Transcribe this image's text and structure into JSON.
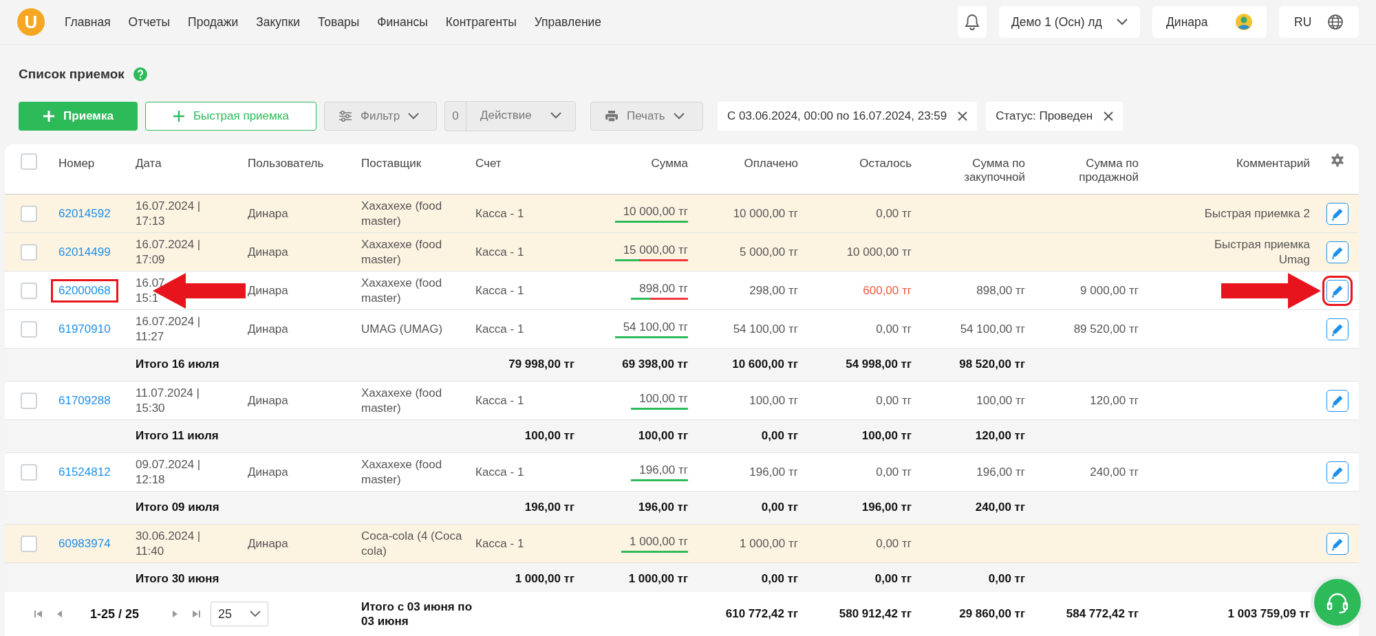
{
  "nav": {
    "logo": "U",
    "items": [
      "Главная",
      "Отчеты",
      "Продажи",
      "Закупки",
      "Товары",
      "Финансы",
      "Контрагенты",
      "Управление"
    ]
  },
  "header_right": {
    "company": "Демо 1 (Осн) лд",
    "user": "Динара",
    "lang": "RU"
  },
  "page": {
    "title": "Список приемок"
  },
  "toolbar": {
    "add": "Приемка",
    "quick_add": "Быстрая приемка",
    "filter": "Фильтр",
    "action_count": "0",
    "action": "Действие",
    "print": "Печать",
    "chips": [
      {
        "label": "С 03.06.2024, 00:00 по 16.07.2024, 23:59"
      },
      {
        "label": "Статус: Проведен"
      }
    ]
  },
  "table": {
    "all_checked": false,
    "columns": [
      "Номер",
      "Дата",
      "Пользователь",
      "Поставщик",
      "Счет",
      "Сумма",
      "Оплачено",
      "Осталось",
      "Сумма по закупочной",
      "Сумма по продажной",
      "Комментарий"
    ],
    "rows": [
      {
        "kind": "doc",
        "checked": false,
        "highlighted": true,
        "annotated": false,
        "number": "62014592",
        "date": "16.07.2024 |",
        "time": "17:13",
        "user": "Динара",
        "supplier": "Хахахехе (food master)",
        "account": "Касса - 1",
        "sum": "10 000,00 тг",
        "level": 1,
        "paid": "10 000,00 тг",
        "remaining": "0,00 тг",
        "remaining_alert": false,
        "comment": "Быстрая приемка 2"
      },
      {
        "kind": "doc",
        "checked": false,
        "highlighted": true,
        "annotated": false,
        "number": "62014499",
        "date": "16.07.2024 |",
        "time": "17:09",
        "user": "Динара",
        "supplier": "Хахахехе (food master)",
        "account": "Касса - 1",
        "sum": "15 000,00 тг",
        "level": 0.33,
        "paid": "5 000,00 тг",
        "remaining": "10 000,00 тг",
        "remaining_alert": false,
        "comment": "Быстрая приемка Umag"
      },
      {
        "kind": "doc",
        "checked": false,
        "highlighted": false,
        "annotated": true,
        "number": "62000068",
        "date": "16.07",
        "time": "15:1",
        "user": "Динара",
        "supplier": "Хахахехе (food master)",
        "account": "Касса - 1",
        "sum": "898,00 тг",
        "level": 0.33,
        "paid": "298,00 тг",
        "remaining": "600,00 тг",
        "remaining_alert": true,
        "purchase": "898,00 тг",
        "sale": "9 000,00 тг"
      },
      {
        "kind": "doc",
        "checked": false,
        "highlighted": false,
        "annotated": false,
        "number": "61970910",
        "date": "16.07.2024 |",
        "time": "11:27",
        "user": "Динара",
        "supplier": "UMAG (UMAG)",
        "account": "Касса - 1",
        "sum": "54 100,00 тг",
        "level": 1,
        "paid": "54 100,00 тг",
        "remaining": "0,00 тг",
        "remaining_alert": false,
        "purchase": "54 100,00 тг",
        "sale": "89 520,00 тг"
      },
      {
        "kind": "total",
        "label": "Итого 16 июля",
        "sum": "79 998,00 тг",
        "paid": "69 398,00 тг",
        "remaining": "10 600,00 тг",
        "purchase": "54 998,00 тг",
        "sale": "98 520,00 тг"
      },
      {
        "kind": "doc",
        "checked": false,
        "highlighted": false,
        "annotated": false,
        "number": "61709288",
        "date": "11.07.2024 |",
        "time": "15:30",
        "user": "Динара",
        "supplier": "Хахахехе (food master)",
        "account": "Касса - 1",
        "sum": "100,00 тг",
        "level": 1,
        "paid": "100,00 тг",
        "remaining": "0,00 тг",
        "remaining_alert": false,
        "purchase": "100,00 тг",
        "sale": "120,00 тг"
      },
      {
        "kind": "total",
        "label": "Итого 11 июля",
        "sum": "100,00 тг",
        "paid": "100,00 тг",
        "remaining": "0,00 тг",
        "purchase": "100,00 тг",
        "sale": "120,00 тг"
      },
      {
        "kind": "doc",
        "checked": false,
        "highlighted": false,
        "annotated": false,
        "number": "61524812",
        "date": "09.07.2024 |",
        "time": "12:18",
        "user": "Динара",
        "supplier": "Хахахехе (food master)",
        "account": "Касса - 1",
        "sum": "196,00 тг",
        "level": 1,
        "paid": "196,00 тг",
        "remaining": "0,00 тг",
        "remaining_alert": false,
        "purchase": "196,00 тг",
        "sale": "240,00 тг"
      },
      {
        "kind": "total",
        "label": "Итого 09 июля",
        "sum": "196,00 тг",
        "paid": "196,00 тг",
        "remaining": "0,00 тг",
        "purchase": "196,00 тг",
        "sale": "240,00 тг"
      },
      {
        "kind": "doc",
        "checked": false,
        "highlighted": true,
        "annotated": false,
        "number": "60983974",
        "date": "30.06.2024 |",
        "time": "11:40",
        "user": "Динара",
        "supplier": "Coca-cola (4 (Coca cola)",
        "account": "Касса - 1",
        "sum": "1 000,00 тг",
        "level": 1,
        "paid": "1 000,00 тг",
        "remaining": "0,00 тг",
        "remaining_alert": false
      },
      {
        "kind": "total",
        "label": "Итого 30 июня",
        "sum": "1 000,00 тг",
        "paid": "1 000,00 тг",
        "remaining": "0,00 тг",
        "purchase": "0,00 тг",
        "sale": "0,00 тг"
      }
    ]
  },
  "footer": {
    "range": "1-25 / 25",
    "page_size": "25",
    "label": "Итого с 03 июня по 03 июня",
    "sum": "610 772,42 тг",
    "paid": "580 912,42 тг",
    "remaining": "29 860,00 тг",
    "purchase": "584 772,42 тг",
    "sale": "1 003 759,09 тг"
  }
}
